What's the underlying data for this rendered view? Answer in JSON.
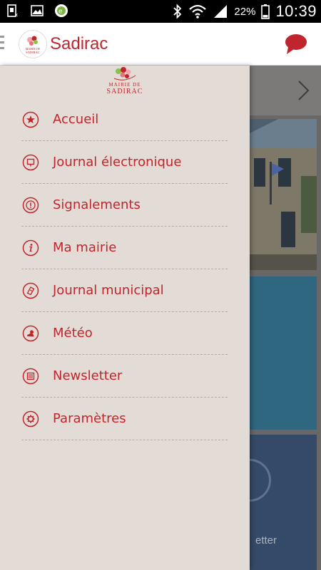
{
  "status_bar": {
    "battery_percent": "22%",
    "time": "10:39",
    "icons": [
      "sim-icon",
      "gallery-icon",
      "app-notification-icon",
      "bluetooth-icon",
      "wifi-icon",
      "signal-icon",
      "battery-icon"
    ]
  },
  "app_bar": {
    "title": "Sadirac",
    "logo_text_top": "MAIRIE DE",
    "logo_text_bottom": "SADIRAC",
    "accent_color": "#c0252d"
  },
  "drawer": {
    "logo_text_top": "MAIRIE DE",
    "logo_text_bottom": "SADIRAC",
    "items": [
      {
        "label": "Accueil",
        "icon": "star-icon"
      },
      {
        "label": "Journal électronique",
        "icon": "screen-icon"
      },
      {
        "label": "Signalements",
        "icon": "alert-icon"
      },
      {
        "label": "Ma mairie",
        "icon": "info-icon"
      },
      {
        "label": "Journal municipal",
        "icon": "newspaper-icon"
      },
      {
        "label": "Météo",
        "icon": "weather-icon"
      },
      {
        "label": "Newsletter",
        "icon": "newsletter-icon"
      },
      {
        "label": "Paramètres",
        "icon": "settings-icon"
      }
    ]
  },
  "background": {
    "newsletter_label_partial": "etter"
  }
}
